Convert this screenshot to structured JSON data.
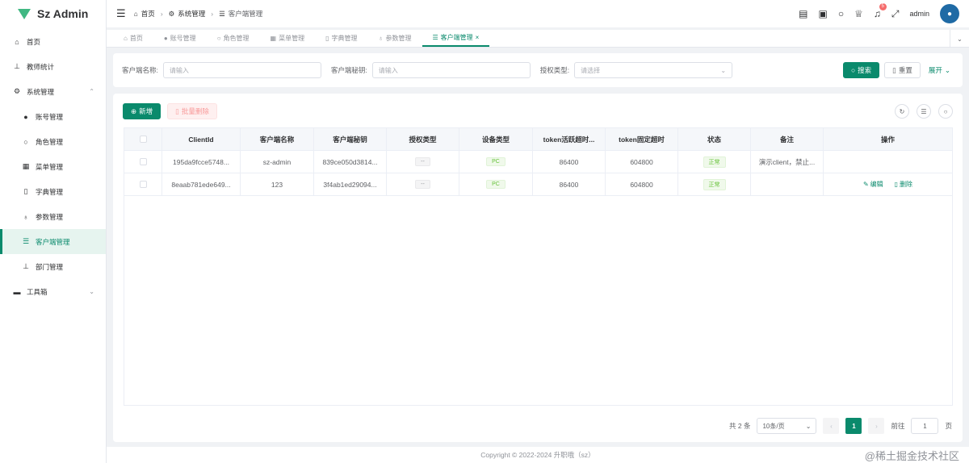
{
  "app": {
    "title": "Sz Admin"
  },
  "sidebar": {
    "items": [
      {
        "label": "首页",
        "icon": "home-icon"
      },
      {
        "label": "教师统计",
        "icon": "org-chart-icon"
      },
      {
        "label": "系统管理",
        "icon": "gear-icon",
        "expanded": true
      },
      {
        "label": "账号管理",
        "icon": "user-icon"
      },
      {
        "label": "角色管理",
        "icon": "user-outline-icon"
      },
      {
        "label": "菜单管理",
        "icon": "grid-icon"
      },
      {
        "label": "字典管理",
        "icon": "book-icon"
      },
      {
        "label": "参数管理",
        "icon": "param-icon"
      },
      {
        "label": "客户端管理",
        "icon": "sliders-icon",
        "active": true
      },
      {
        "label": "部门管理",
        "icon": "org-chart-icon"
      },
      {
        "label": "工具箱",
        "icon": "toolbox-icon",
        "expanded": false
      }
    ]
  },
  "header": {
    "breadcrumb": [
      "首页",
      "系统管理",
      "客户端管理"
    ],
    "notification_count": "5",
    "username": "admin"
  },
  "tabs": [
    {
      "label": "首页"
    },
    {
      "label": "账号管理"
    },
    {
      "label": "角色管理"
    },
    {
      "label": "菜单管理"
    },
    {
      "label": "字典管理"
    },
    {
      "label": "参数管理"
    },
    {
      "label": "客户端管理",
      "active": true
    }
  ],
  "search": {
    "client_name_label": "客户端名称:",
    "client_name_placeholder": "请输入",
    "client_secret_label": "客户端秘钥:",
    "client_secret_placeholder": "请输入",
    "grant_type_label": "授权类型:",
    "grant_type_placeholder": "请选择",
    "search_button": "搜索",
    "reset_button": "重置",
    "expand_button": "展开"
  },
  "toolbar": {
    "add_button": "新增",
    "batch_delete_button": "批量删除"
  },
  "table": {
    "columns": [
      "ClientId",
      "客户端名称",
      "客户端秘钥",
      "授权类型",
      "设备类型",
      "token活跃超时...",
      "token固定超时",
      "状态",
      "备注",
      "操作"
    ],
    "rows": [
      {
        "client_id": "195da9fcce5748...",
        "name": "sz-admin",
        "secret": "839ce050d3814...",
        "grant_type": "--",
        "device_type": "PC",
        "active_timeout": "86400",
        "fixed_timeout": "604800",
        "status": "正常",
        "remark": "演示client，禁止...",
        "actions": false
      },
      {
        "client_id": "8eaab781ede649...",
        "name": "123",
        "secret": "3f4ab1ed29094...",
        "grant_type": "--",
        "device_type": "PC",
        "active_timeout": "86400",
        "fixed_timeout": "604800",
        "status": "正常",
        "remark": "",
        "actions": true
      }
    ],
    "edit_label": "编辑",
    "delete_label": "删除"
  },
  "pagination": {
    "total_text": "共 2 条",
    "page_size": "10条/页",
    "current_page": "1",
    "goto_label": "前往",
    "goto_value": "1",
    "page_suffix": "页"
  },
  "footer": {
    "copyright": "Copyright © 2022-2024 升职哦（sz）"
  },
  "watermark": "@稀土掘金技术社区",
  "colors": {
    "primary": "#0a8a6c",
    "success": "#67c23a",
    "danger": "#f56c6c"
  }
}
